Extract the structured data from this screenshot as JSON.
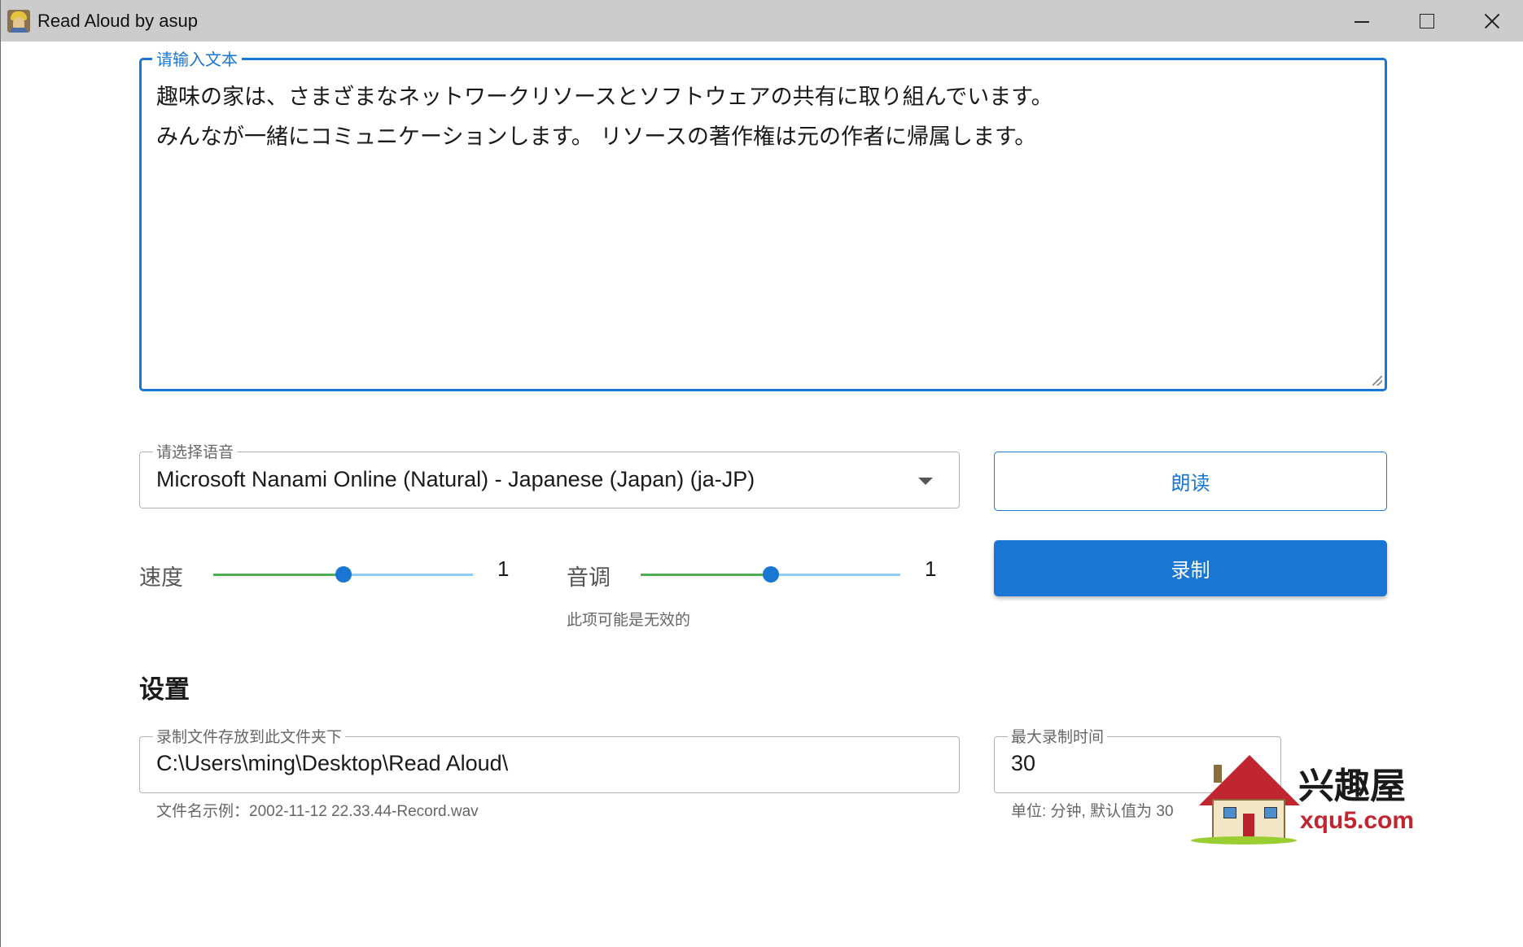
{
  "window": {
    "title": "Read Aloud by asup"
  },
  "text_input": {
    "label": "请输入文本",
    "lines": [
      "趣味の家は、さまざまなネットワークリソースとソフトウェアの共有に取り組んでいます。",
      "みんなが一緒にコミュニケーションします。 リソースの著作権は元の作者に帰属します。"
    ]
  },
  "voice_select": {
    "label": "请选择语音",
    "value": "Microsoft Nanami Online (Natural) - Japanese (Japan) (ja-JP)"
  },
  "buttons": {
    "read": "朗读",
    "record": "录制"
  },
  "speed": {
    "label": "速度",
    "value": "1",
    "position_fraction": 0.5
  },
  "pitch": {
    "label": "音调",
    "value": "1",
    "position_fraction": 0.5,
    "helper": "此项可能是无效的"
  },
  "settings": {
    "title": "设置",
    "folder": {
      "label": "录制文件存放到此文件夹下",
      "value": "C:\\Users\\ming\\Desktop\\Read Aloud\\",
      "helper": "文件名示例：2002-11-12 22.33.44-Record.wav"
    },
    "max_time": {
      "label": "最大录制时间",
      "value": "30",
      "helper": "单位: 分钟, 默认值为 30"
    }
  },
  "watermark": {
    "brand": "兴趣屋",
    "site": "xqu5.com"
  },
  "colors": {
    "accent": "#1976d2",
    "slider_filled": "#4caf50",
    "slider_rail": "#90caf9",
    "titlebar": "#cccccc"
  },
  "icons": {
    "app": "avatar-icon",
    "minimize": "minimize-icon",
    "maximize": "maximize-icon",
    "close": "close-icon",
    "dropdown": "chevron-down-icon"
  }
}
